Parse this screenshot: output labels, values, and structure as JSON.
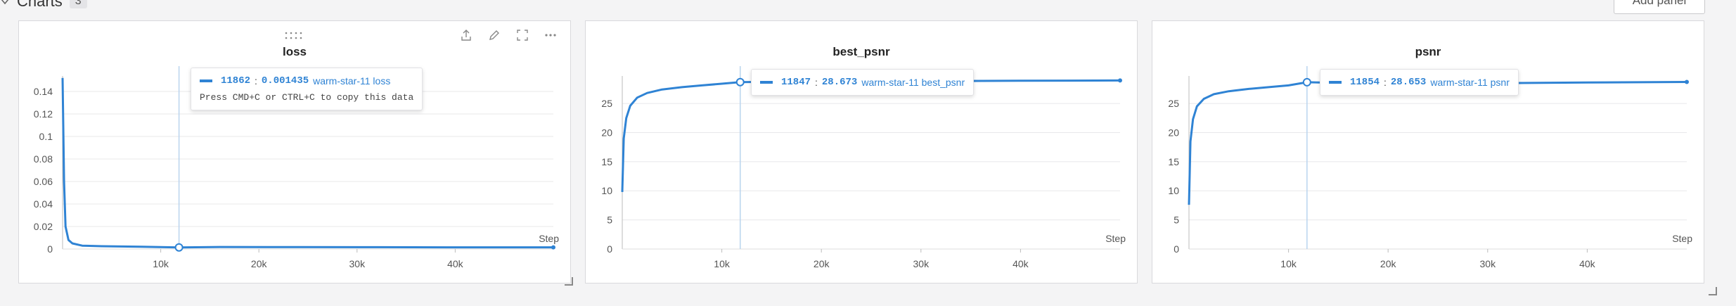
{
  "section": {
    "title": "Charts",
    "count": "3",
    "add_panel_label": "Add panel"
  },
  "panels": [
    {
      "title": "loss",
      "tooltip": {
        "step": "11862",
        "value": "0.001435",
        "series": "warm-star-11 loss",
        "hint": "Press CMD+C or CTRL+C to copy this data"
      }
    },
    {
      "title": "best_psnr",
      "tooltip": {
        "step": "11847",
        "value": "28.673",
        "series": "warm-star-11 best_psnr"
      }
    },
    {
      "title": "psnr",
      "tooltip": {
        "step": "11854",
        "value": "28.653",
        "series": "warm-star-11 psnr"
      }
    }
  ],
  "colors": {
    "series": "#2f83d4",
    "grid": "#e8e8ea",
    "crosshair": "#b9d4ee"
  },
  "chart_data": [
    {
      "type": "line",
      "title": "loss",
      "xlabel": "Step",
      "ylabel": "",
      "xlim": [
        0,
        50000
      ],
      "ylim": [
        0,
        0.15
      ],
      "xticks": [
        "10k",
        "20k",
        "30k",
        "40k"
      ],
      "yticks": [
        "0",
        "0.02",
        "0.04",
        "0.06",
        "0.08",
        "0.1",
        "0.12",
        "0.14"
      ],
      "grid": true,
      "series": [
        {
          "name": "warm-star-11 loss",
          "x": [
            0,
            150,
            300,
            600,
            1000,
            2000,
            4000,
            8000,
            11862,
            16000,
            24000,
            32000,
            40000,
            50000
          ],
          "y": [
            0.152,
            0.06,
            0.02,
            0.008,
            0.005,
            0.003,
            0.0025,
            0.002,
            0.001435,
            0.0018,
            0.0017,
            0.0016,
            0.0015,
            0.0015
          ]
        }
      ],
      "hover_x": 11862,
      "hover_y": 0.001435
    },
    {
      "type": "line",
      "title": "best_psnr",
      "xlabel": "Step",
      "ylabel": "",
      "xlim": [
        0,
        50000
      ],
      "ylim": [
        0,
        29
      ],
      "xticks": [
        "10k",
        "20k",
        "30k",
        "40k"
      ],
      "yticks": [
        "0",
        "5",
        "10",
        "15",
        "20",
        "25"
      ],
      "grid": true,
      "series": [
        {
          "name": "warm-star-11 best_psnr",
          "x": [
            0,
            150,
            400,
            800,
            1500,
            2500,
            4000,
            6000,
            8000,
            10000,
            11847,
            16000,
            24000,
            32000,
            40000,
            50000
          ],
          "y": [
            9.8,
            19,
            22.5,
            24.6,
            26,
            26.8,
            27.4,
            27.8,
            28.1,
            28.4,
            28.673,
            28.75,
            28.8,
            28.85,
            28.9,
            28.95
          ]
        }
      ],
      "hover_x": 11847,
      "hover_y": 28.673
    },
    {
      "type": "line",
      "title": "psnr",
      "xlabel": "Step",
      "ylabel": "",
      "xlim": [
        0,
        50000
      ],
      "ylim": [
        0,
        29
      ],
      "xticks": [
        "10k",
        "20k",
        "30k",
        "40k"
      ],
      "yticks": [
        "0",
        "5",
        "10",
        "15",
        "20",
        "25"
      ],
      "grid": true,
      "series": [
        {
          "name": "warm-star-11 psnr",
          "x": [
            0,
            150,
            400,
            800,
            1500,
            2500,
            4000,
            6000,
            8000,
            10000,
            11854,
            16000,
            24000,
            32000,
            40000,
            50000
          ],
          "y": [
            7.6,
            18.5,
            22.3,
            24.5,
            25.8,
            26.6,
            27.1,
            27.5,
            27.8,
            28.1,
            28.653,
            28.5,
            28.6,
            28.5,
            28.6,
            28.7
          ]
        }
      ],
      "hover_x": 11854,
      "hover_y": 28.653
    }
  ]
}
